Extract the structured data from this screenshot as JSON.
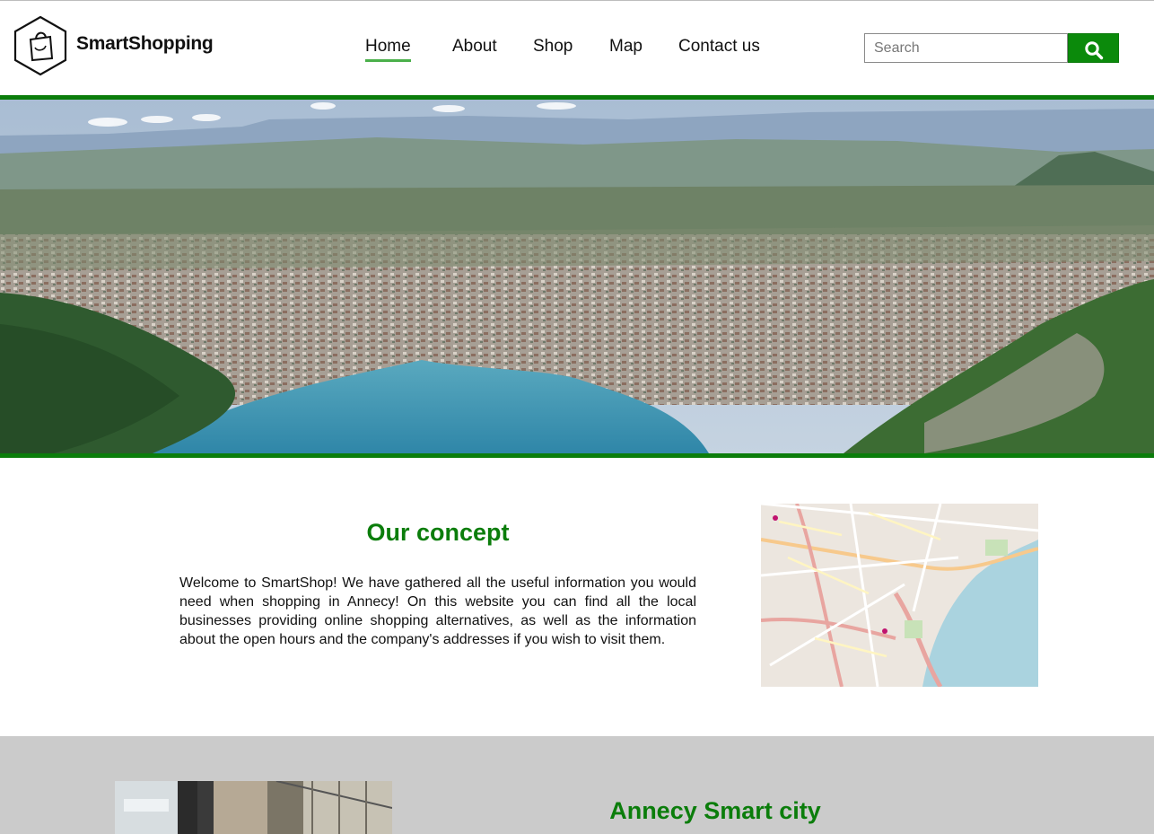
{
  "brand": {
    "name": "SmartShopping",
    "logo_icon": "shopping-bag-hexagon-icon"
  },
  "nav": {
    "items": [
      {
        "label": "Home",
        "active": true
      },
      {
        "label": "About",
        "active": false
      },
      {
        "label": "Shop",
        "active": false
      },
      {
        "label": "Map",
        "active": false
      },
      {
        "label": "Contact us",
        "active": false
      }
    ]
  },
  "search": {
    "placeholder": "Search",
    "value": "",
    "button_icon": "search-icon"
  },
  "colors": {
    "accent": "#0b7d0b",
    "nav_underline": "#4bb04b",
    "grey_section": "#cbcbcb"
  },
  "hero": {
    "image": "Annecy city and lake aerial view"
  },
  "concept": {
    "title": "Our concept",
    "text": "Welcome to SmartShop! We have gathered all the useful information you would need when shopping in Annecy! On this website you can find all the local businesses providing online shopping alternatives, as well as the information about the open hours and the company's addresses if you wish to visit them.",
    "map_image": "Annecy street map"
  },
  "smart_city": {
    "title": "Annecy Smart city",
    "image": "shopping mall interior"
  }
}
